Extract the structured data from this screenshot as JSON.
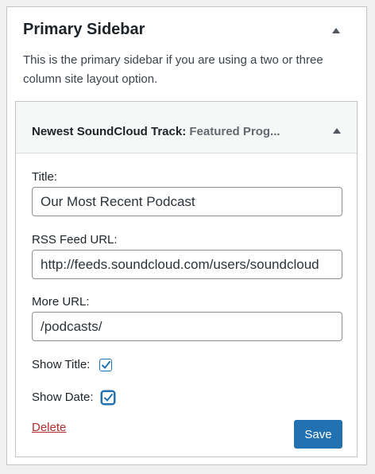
{
  "sidebar": {
    "title": "Primary Sidebar",
    "description": "This is the primary sidebar if you are using a two or three column site layout option."
  },
  "widget": {
    "title": "Newest SoundCloud Track",
    "separator": ": ",
    "subtitle": "Featured Prog...",
    "fields": {
      "title_label": "Title:",
      "title_value": "Our Most Recent Podcast",
      "rss_label": "RSS Feed URL:",
      "rss_value": "http://feeds.soundcloud.com/users/soundcloud",
      "more_label": "More URL:",
      "more_value": "/podcasts/"
    },
    "show_title": {
      "label": "Show Title:",
      "checked": true
    },
    "show_date": {
      "label": "Show Date:",
      "checked": true
    },
    "delete_label": "Delete",
    "save_label": "Save"
  },
  "colors": {
    "accent": "#2271b1",
    "danger": "#b32d2e"
  },
  "icons": {
    "panel_toggle": "triangle-up-icon",
    "widget_toggle": "triangle-up-icon",
    "checkmark": "checkmark-icon"
  }
}
